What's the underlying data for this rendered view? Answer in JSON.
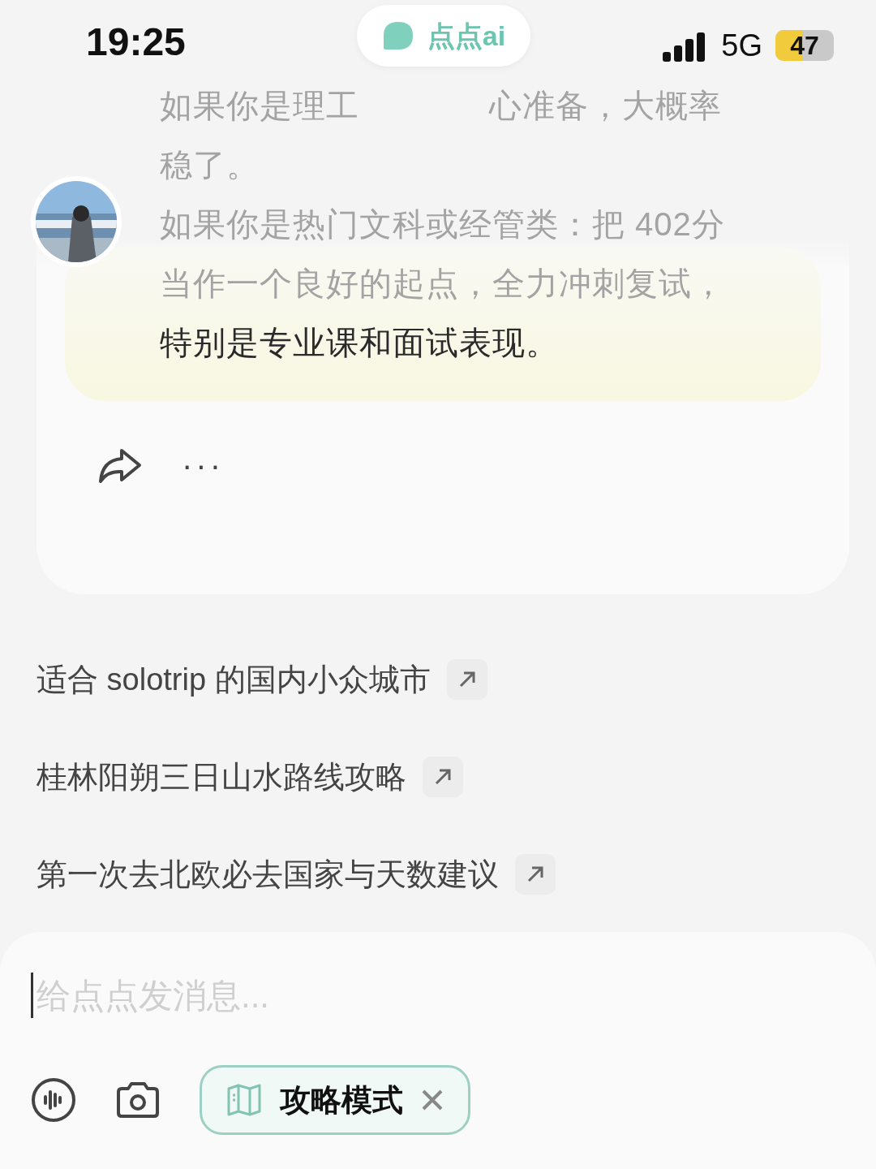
{
  "status_bar": {
    "time": "19:25",
    "network": "5G",
    "battery": "47"
  },
  "app_pill": {
    "label": "点点ai"
  },
  "message": {
    "lines": [
      {
        "parts": [
          "如果你是理工",
          "心准备，大概率"
        ],
        "faded": true
      },
      {
        "parts": [
          "稳了。"
        ],
        "faded": true
      },
      {
        "parts": [
          "如果你是热门文科或经管类：把 402分"
        ],
        "faded": true
      },
      {
        "parts": [
          "当作一个良好的起点，全力冲刺复试，"
        ],
        "faded": true
      },
      {
        "parts": [
          "特别是专业课和面试表现。"
        ],
        "faded": false
      }
    ],
    "actions": [
      {
        "kind": "share"
      },
      {
        "kind": "more",
        "label": "···"
      }
    ]
  },
  "suggestions": [
    {
      "text": "适合 solotrip 的国内小众城市"
    },
    {
      "text": "桂林阳朔三日山水路线攻略"
    },
    {
      "text": "第一次去北欧必去国家与天数建议"
    }
  ],
  "composer": {
    "placeholder": "给点点发消息...",
    "tools": [
      {
        "kind": "voice"
      },
      {
        "kind": "camera"
      }
    ],
    "mode_chip": {
      "label": "攻略模式"
    }
  }
}
